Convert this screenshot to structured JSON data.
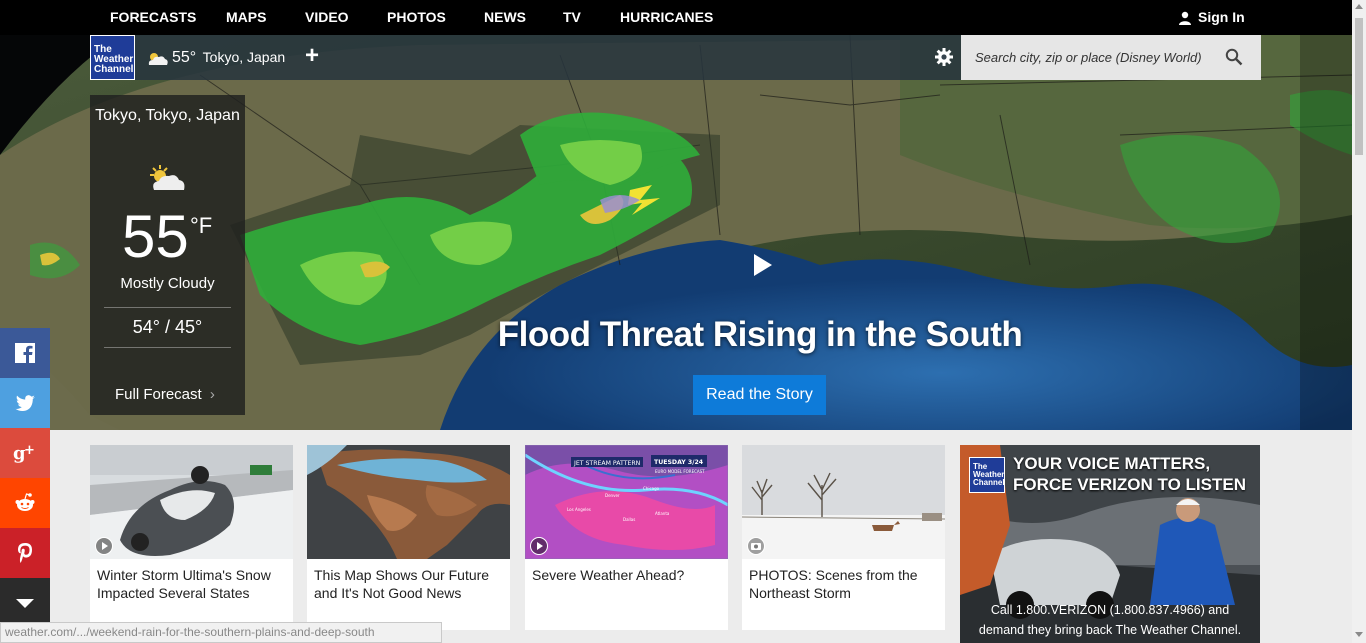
{
  "nav": {
    "items": [
      {
        "label": "FORECASTS",
        "name": "nav-forecasts"
      },
      {
        "label": "MAPS",
        "name": "nav-maps"
      },
      {
        "label": "VIDEO",
        "name": "nav-video"
      },
      {
        "label": "PHOTOS",
        "name": "nav-photos"
      },
      {
        "label": "NEWS",
        "name": "nav-news"
      },
      {
        "label": "TV",
        "name": "nav-tv"
      },
      {
        "label": "HURRICANES",
        "name": "nav-hurricanes"
      }
    ],
    "sign_in": "Sign In"
  },
  "brand": {
    "logo_text": "The Weather Channel",
    "logo_color": "#1f3c98"
  },
  "location_bar": {
    "temp": "55°",
    "city": "Tokyo, Japan",
    "add_icon": "plus-icon",
    "settings_icon": "gear-icon"
  },
  "search": {
    "placeholder": "Search city, zip or place (Disney World)"
  },
  "conditions": {
    "location": "Tokyo, Tokyo, Japan",
    "icon": "partly-cloudy-icon",
    "temp": "55",
    "unit": "°F",
    "phrase": "Mostly Cloudy",
    "hi_lo": "54° / 45°",
    "full_forecast": "Full Forecast"
  },
  "hero": {
    "headline": "Flood Threat Rising in the South",
    "cta": "Read the Story",
    "cta_color": "#0e7bd9"
  },
  "social": [
    {
      "name": "facebook",
      "color": "#3b5998"
    },
    {
      "name": "twitter",
      "color": "#4ea0e0"
    },
    {
      "name": "google-plus",
      "color": "#dc4b3d"
    },
    {
      "name": "reddit",
      "color": "#ff4500"
    },
    {
      "name": "pinterest",
      "color": "#cb2128"
    },
    {
      "name": "more",
      "color": "#2b2b2b"
    }
  ],
  "cards": [
    {
      "title": "Winter Storm Ultima's Snow Impacted Several States",
      "media": "video"
    },
    {
      "title": "This Map Shows Our Future and It's Not Good News",
      "media": "none"
    },
    {
      "title": "Severe Weather Ahead?",
      "media": "video",
      "thumb_text": {
        "left": "JET STREAM PATTERN",
        "right": "TUESDAY 3/24",
        "sub": "EURO MODEL FORECAST",
        "cities": [
          "Chicago",
          "Denver",
          "Atlanta",
          "Los Angeles",
          "Dallas"
        ]
      }
    },
    {
      "title": "PHOTOS: Scenes from the Northeast Storm",
      "media": "photo"
    }
  ],
  "ad": {
    "headline_1": "YOUR VOICE MATTERS,",
    "headline_2": "FORCE VERIZON TO LISTEN",
    "line1": "Call 1.800.VERIZON (1.800.837.4966) and",
    "line2": "demand they bring back The Weather Channel.",
    "logo_text": "The Weather Channel"
  },
  "status_url": "weather.com/.../weekend-rain-for-the-southern-plains-and-deep-south"
}
